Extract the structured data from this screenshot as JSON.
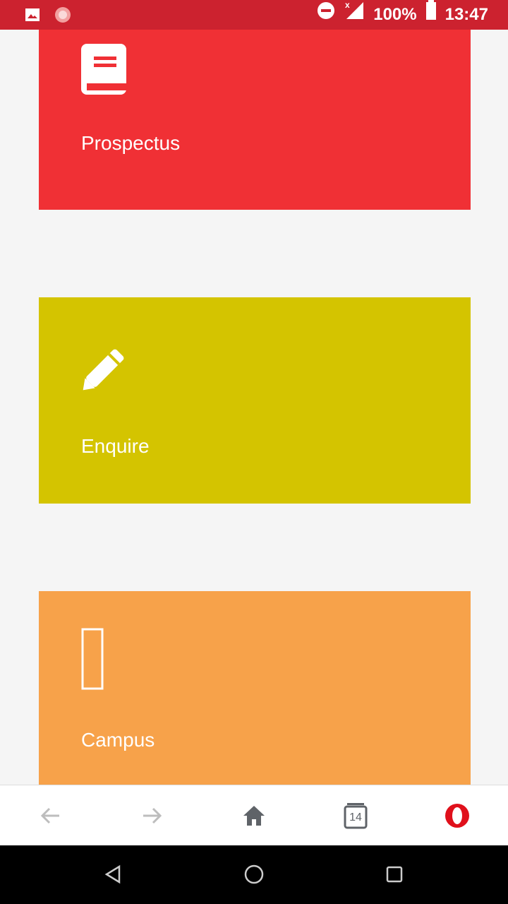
{
  "status_bar": {
    "battery": "100%",
    "time": "13:47",
    "icons": [
      "image-icon",
      "app-icon",
      "do-not-disturb-icon",
      "signal-icon",
      "battery-icon"
    ]
  },
  "tiles": [
    {
      "label": "Prospectus",
      "icon": "book-icon",
      "color": "#f03035"
    },
    {
      "label": "Enquire",
      "icon": "pencil-icon",
      "color": "#d4c400"
    },
    {
      "label": "Campus",
      "icon": "campus-icon",
      "color": "#f7a24a"
    }
  ],
  "browser_bar": {
    "tab_count": "14",
    "icons": [
      "back-arrow-icon",
      "forward-arrow-icon",
      "home-icon",
      "tabs-icon",
      "opera-menu-icon"
    ]
  },
  "nav_bar": {
    "icons": [
      "back-triangle-icon",
      "home-circle-icon",
      "recents-square-icon"
    ]
  },
  "colors": {
    "status_bar": "#cc222f",
    "background": "#f5f5f5"
  }
}
